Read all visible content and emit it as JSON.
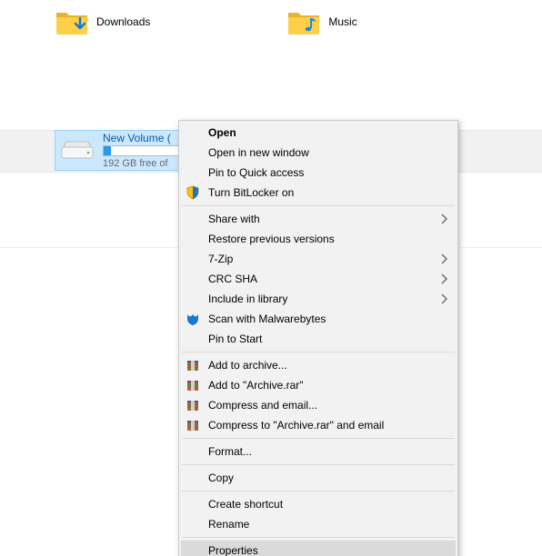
{
  "folders": {
    "downloads": {
      "label": "Downloads"
    },
    "music": {
      "label": "Music"
    }
  },
  "drive": {
    "name": "New Volume (",
    "free": "192 GB free of"
  },
  "menu": {
    "open": "Open",
    "open_new": "Open in new window",
    "pin_qa": "Pin to Quick access",
    "bitlocker": "Turn BitLocker on",
    "share": "Share with",
    "restore": "Restore previous versions",
    "sevenzip": "7-Zip",
    "crcsha": "CRC SHA",
    "include": "Include in library",
    "malware": "Scan with Malwarebytes",
    "pin_start": "Pin to Start",
    "add_arch": "Add to archive...",
    "add_rar": "Add to \"Archive.rar\"",
    "comp_email": "Compress and email...",
    "comp_rar_em": "Compress to \"Archive.rar\" and email",
    "format": "Format...",
    "copy": "Copy",
    "shortcut": "Create shortcut",
    "rename": "Rename",
    "properties": "Properties"
  }
}
